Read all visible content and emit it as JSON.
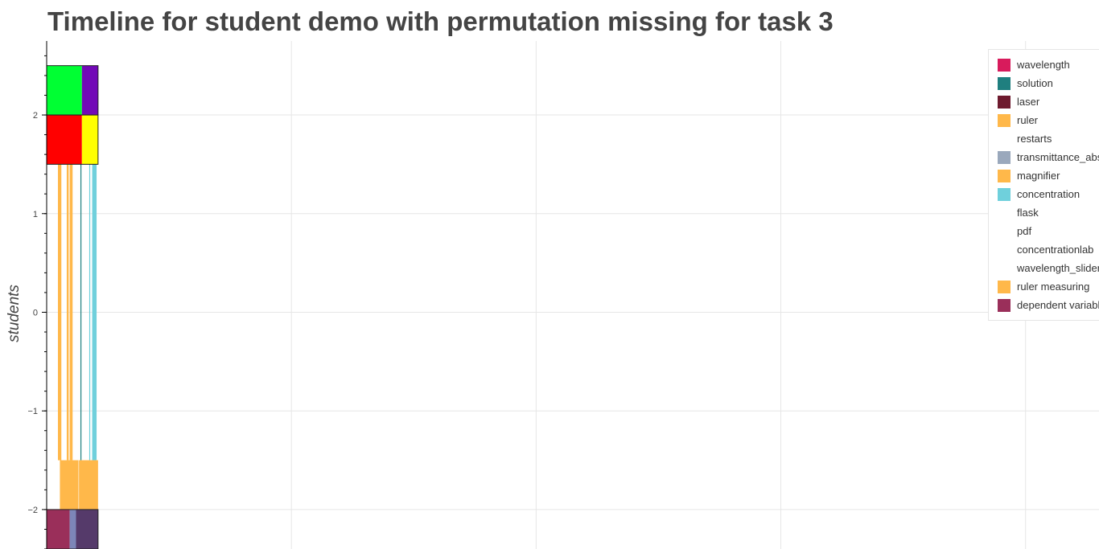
{
  "chart_data": {
    "type": "bar",
    "title": "Timeline for student demo with permutation missing for task 3",
    "xlabel": "",
    "ylabel": "students",
    "ylim": [
      -2.4,
      2.75
    ],
    "xlim": [
      0,
      21.5
    ],
    "yticks": [
      -2,
      -1,
      0,
      1,
      2
    ],
    "ytick_labels": [
      "−2",
      "−1",
      "0",
      "1",
      "2"
    ],
    "grid": true,
    "legend_position": "top-right",
    "legend": [
      {
        "label": "wavelength",
        "color": "#d81b5c"
      },
      {
        "label": "solution",
        "color": "#1f7f7f"
      },
      {
        "label": "laser",
        "color": "#6e1a2e"
      },
      {
        "label": "ruler",
        "color": "#ffb84a"
      },
      {
        "label": "restarts",
        "color": "#ffffff"
      },
      {
        "label": "transmittance_abs",
        "color": "#9aa8bc"
      },
      {
        "label": "magnifier",
        "color": "#ffb84a"
      },
      {
        "label": "concentration",
        "color": "#6fd0dc"
      },
      {
        "label": "flask",
        "color": "#ffffff"
      },
      {
        "label": "pdf",
        "color": "#ffffff"
      },
      {
        "label": "concentrationlab",
        "color": "#ffffff"
      },
      {
        "label": "wavelength_slider",
        "color": "#ffffff"
      },
      {
        "label": "ruler measuring",
        "color": "#ffb84a"
      },
      {
        "label": "dependent variable",
        "color": "#9a2f5a"
      }
    ],
    "segments": [
      {
        "y0": 2.0,
        "y1": 2.5,
        "x0": 0.0,
        "x1": 0.72,
        "color": "#00ff33"
      },
      {
        "y0": 2.0,
        "y1": 2.5,
        "x0": 0.72,
        "x1": 1.05,
        "color": "#7209b7"
      },
      {
        "y0": 1.5,
        "y1": 2.0,
        "x0": 0.0,
        "x1": 0.72,
        "color": "#ff0000"
      },
      {
        "y0": 1.5,
        "y1": 2.0,
        "x0": 0.72,
        "x1": 1.05,
        "color": "#ffff00"
      },
      {
        "y0": -1.5,
        "y1": 1.5,
        "x0": 0.23,
        "x1": 0.3,
        "color": "#ffb84a"
      },
      {
        "y0": -1.5,
        "y1": 1.5,
        "x0": 0.41,
        "x1": 0.45,
        "color": "#ffb84a"
      },
      {
        "y0": -1.5,
        "y1": 1.5,
        "x0": 0.47,
        "x1": 0.53,
        "color": "#ffb84a"
      },
      {
        "y0": -1.5,
        "y1": 1.5,
        "x0": 0.69,
        "x1": 0.71,
        "color": "#1f7f7f"
      },
      {
        "y0": -1.5,
        "y1": 1.5,
        "x0": 0.87,
        "x1": 0.89,
        "color": "#6fd0dc"
      },
      {
        "y0": -1.5,
        "y1": 1.5,
        "x0": 0.93,
        "x1": 1.02,
        "color": "#6fd0dc"
      },
      {
        "y0": -2.0,
        "y1": -1.5,
        "x0": 0.27,
        "x1": 0.65,
        "color": "#ffb84a"
      },
      {
        "y0": -2.0,
        "y1": -1.5,
        "x0": 0.66,
        "x1": 1.05,
        "color": "#ffb84a"
      },
      {
        "y0": -2.4,
        "y1": -2.0,
        "x0": 0.0,
        "x1": 0.47,
        "color": "#9a2f5a"
      },
      {
        "y0": -2.4,
        "y1": -2.0,
        "x0": 0.47,
        "x1": 0.6,
        "color": "#7d86b8"
      },
      {
        "y0": -2.4,
        "y1": -2.0,
        "x0": 0.6,
        "x1": 1.05,
        "color": "#553a6a"
      }
    ]
  }
}
